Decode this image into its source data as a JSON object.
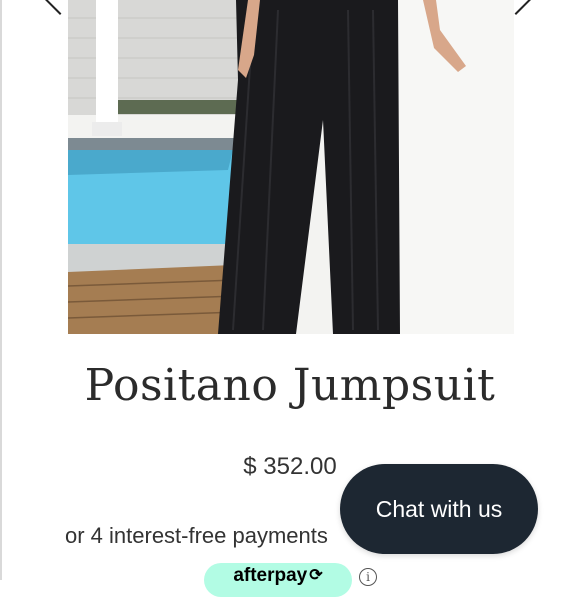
{
  "product": {
    "title": "Positano Jumpsuit",
    "price": "$ 352.00",
    "installments_text": "or 4 interest-free payments"
  },
  "chat": {
    "label": "Chat with us"
  },
  "afterpay": {
    "label": "afterpay",
    "mark": "⟳",
    "info": "i"
  },
  "colors": {
    "chat_bg": "#1d2732",
    "afterpay_bg": "#b2fce4",
    "pool": "#5fc6e8",
    "garment": "#1a1a1d"
  },
  "icons": [
    "chevron-left-icon",
    "chevron-right-icon",
    "info-icon",
    "afterpay-logo-icon"
  ]
}
